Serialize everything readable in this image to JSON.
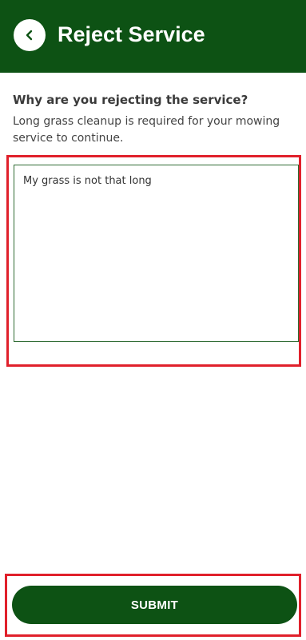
{
  "header": {
    "title": "Reject Service",
    "back_icon": "chevron-left-icon"
  },
  "form": {
    "question": "Why are you rejecting the service?",
    "description": "Long grass cleanup is required for your mowing service to continue.",
    "reason_value": "My grass is not that long"
  },
  "footer": {
    "submit_label": "SUBMIT"
  },
  "colors": {
    "brand_green": "#0d5214",
    "highlight_red": "#e0202b"
  }
}
